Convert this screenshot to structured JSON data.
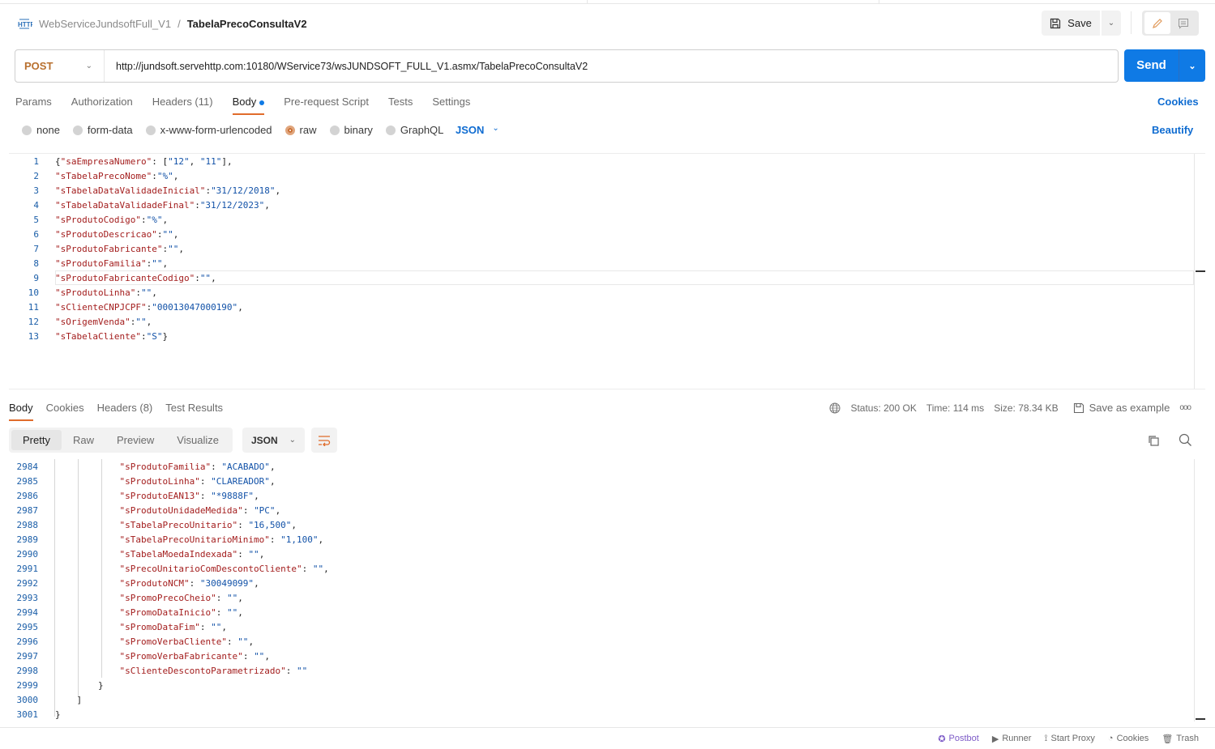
{
  "breadcrumb": {
    "icon": "http-icon",
    "parent": "WebServiceJundsoftFull_V1",
    "separator": "/",
    "current": "TabelaPrecoConsultaV2"
  },
  "toolbar": {
    "save_label": "Save"
  },
  "request": {
    "method": "POST",
    "url": "http://jundsoft.servehttp.com:10180/WService73/wsJUNDSOFT_FULL_V1.asmx/TabelaPrecoConsultaV2",
    "send_label": "Send"
  },
  "request_tabs": [
    "Params",
    "Authorization",
    "Headers (11)",
    "Body",
    "Pre-request Script",
    "Tests",
    "Settings"
  ],
  "active_request_tab": "Body",
  "cookies_label": "Cookies",
  "body_types": [
    "none",
    "form-data",
    "x-www-form-urlencoded",
    "raw",
    "binary",
    "GraphQL"
  ],
  "selected_body_type": "raw",
  "body_format": "JSON",
  "beautify_label": "Beautify",
  "request_body": [
    "{\"saEmpresaNumero\": [\"12\", \"11\"],",
    "\"sTabelaPrecoNome\":\"%\",",
    "\"sTabelaDataValidadeInicial\":\"31/12/2018\",",
    "\"sTabelaDataValidadeFinal\":\"31/12/2023\",",
    "\"sProdutoCodigo\":\"%\",",
    "\"sProdutoDescricao\":\"\",",
    "\"sProdutoFabricante\":\"\",",
    "\"sProdutoFamilia\":\"\",",
    "\"sProdutoFabricanteCodigo\":\"\",",
    "\"sProdutoLinha\":\"\",",
    "\"sClienteCNPJCPF\":\"00013047000190\",",
    "\"sOrigemVenda\":\"\",",
    "\"sTabelaCliente\":\"S\"}"
  ],
  "response_tabs": [
    "Body",
    "Cookies",
    "Headers (8)",
    "Test Results"
  ],
  "active_response_tab": "Body",
  "response_meta": {
    "status": "Status: 200 OK",
    "time": "Time: 114 ms",
    "size": "Size: 78.34 KB",
    "save_example": "Save as example"
  },
  "view_modes": [
    "Pretty",
    "Raw",
    "Preview",
    "Visualize"
  ],
  "active_view_mode": "Pretty",
  "response_format": "JSON",
  "response_start_line": 2984,
  "response_body": [
    "            \"sProdutoFamilia\": \"ACABADO\",",
    "            \"sProdutoLinha\": \"CLAREADOR\",",
    "            \"sProdutoEAN13\": \"*9888F\",",
    "            \"sProdutoUnidadeMedida\": \"PC\",",
    "            \"sTabelaPrecoUnitario\": \"16,500\",",
    "            \"sTabelaPrecoUnitarioMinimo\": \"1,100\",",
    "            \"sTabelaMoedaIndexada\": \"\",",
    "            \"sPrecoUnitarioComDescontoCliente\": \"\",",
    "            \"sProdutoNCM\": \"30049099\",",
    "            \"sPromoPrecoCheio\": \"\",",
    "            \"sPromoDataInicio\": \"\",",
    "            \"sPromoDataFim\": \"\",",
    "            \"sPromoVerbaCliente\": \"\",",
    "            \"sPromoVerbaFabricante\": \"\",",
    "            \"sClienteDescontoParametrizado\": \"\"",
    "        }",
    "    ]",
    "}"
  ],
  "footer": [
    {
      "label": "Postbot",
      "icon": "postbot-icon"
    },
    {
      "label": "Runner",
      "icon": "runner-icon"
    },
    {
      "label": "Start Proxy",
      "icon": "proxy-icon"
    },
    {
      "label": "Cookies",
      "icon": "cookie-icon"
    },
    {
      "label": "Trash",
      "icon": "trash-icon"
    }
  ],
  "colors": {
    "accent": "#0f7ae5",
    "method": "#b8702f",
    "tab_underline": "#e06c2b",
    "json_key": "#a31d1d",
    "json_value": "#1252a8",
    "postbot": "#7d5bc7"
  }
}
